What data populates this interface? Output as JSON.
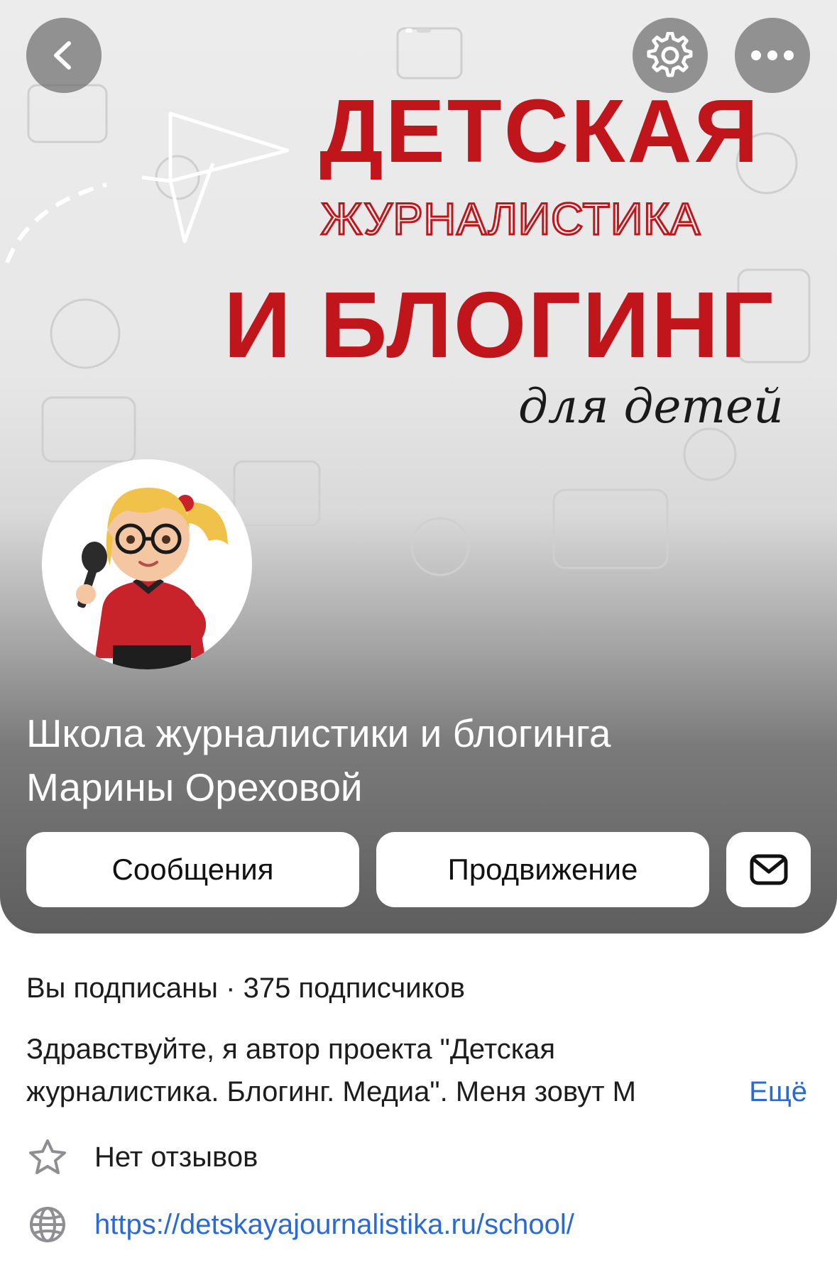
{
  "header": {
    "back_icon": "chevron-left-icon",
    "settings_icon": "gear-icon",
    "more_icon": "ellipsis-icon"
  },
  "banner": {
    "line1": "ДЕТСКАЯ",
    "line2": "ЖУРНАЛИСТИКА",
    "line3": "И БЛОГИНГ",
    "line4": "для детей"
  },
  "profile": {
    "title_line1": "Школа журналистики и блогинга",
    "title_line2": "Марины Ореховой"
  },
  "actions": {
    "messages_label": "Сообщения",
    "promotion_label": "Продвижение",
    "mail_icon": "mail-icon"
  },
  "info": {
    "subscribed_text": "Вы подписаны",
    "separator": "·",
    "subscribers_text": "375 подписчиков",
    "description_line1": "Здравствуйте, я автор проекта \"Детская",
    "description_line2": "журналистика. Блогинг. Медиа\". Меня зовут М",
    "more_label": "Ещё",
    "reviews_text": "Нет отзывов",
    "website_url": "https://detskayajournalistika.ru/school/"
  },
  "colors": {
    "banner_red": "#c0151b",
    "link_blue": "#2a6ad8"
  }
}
